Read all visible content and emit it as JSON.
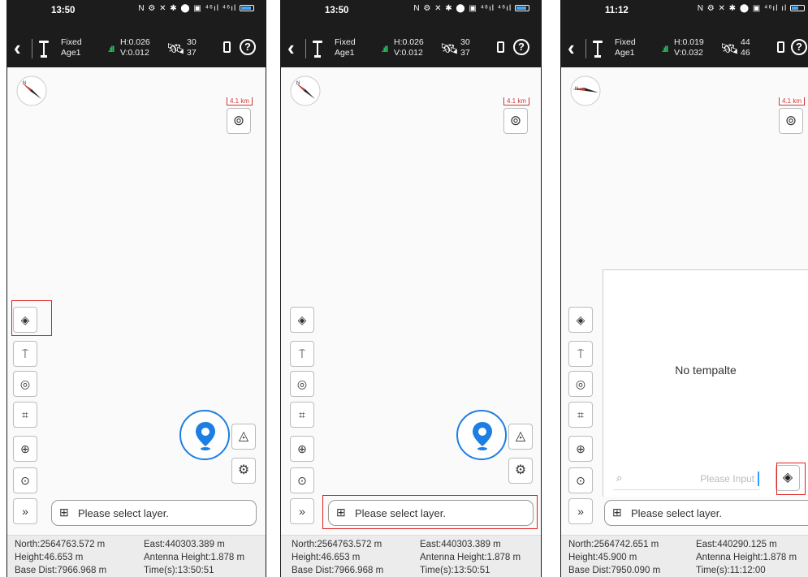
{
  "screens": [
    {
      "time": "13:50",
      "status_icons": "N ⚙ ✕ ✱ ⬤ ▣ ⁴⁶ıl ⁴⁶ıl",
      "fix_status": "Fixed",
      "age": "Age1",
      "h_precision": "H:0.026",
      "v_precision": "V:0.012",
      "sats_used": "30",
      "sats_tracked": "37",
      "scale": "4.1 km",
      "layer_hint": "Please select layer.",
      "north": "North:2564763.572 m",
      "east": "East:440303.389 m",
      "height": "Height:46.653 m",
      "antenna_height": "Antenna Height:1.878 m",
      "base_dist": "Base Dist:7966.968 m",
      "time_s": "Time(s):13:50:51"
    },
    {
      "time": "13:50",
      "status_icons": "N ⚙ ✕ ✱ ⬤ ▣ ⁴⁶ıl ⁴⁶ıl",
      "fix_status": "Fixed",
      "age": "Age1",
      "h_precision": "H:0.026",
      "v_precision": "V:0.012",
      "sats_used": "30",
      "sats_tracked": "37",
      "scale": "4.1 km",
      "layer_hint": "Please select layer.",
      "north": "North:2564763.572 m",
      "east": "East:440303.389 m",
      "height": "Height:46.653 m",
      "antenna_height": "Antenna Height:1.878 m",
      "base_dist": "Base Dist:7966.968 m",
      "time_s": "Time(s):13:50:51"
    },
    {
      "time": "11:12",
      "status_icons": "N ⚙ ✕ ✱ ⬤ ▣ ⁴⁶ıl ıl",
      "fix_status": "Fixed",
      "age": "Age1",
      "h_precision": "H:0.019",
      "v_precision": "V:0.032",
      "sats_used": "44",
      "sats_tracked": "46",
      "scale": "4.1 km",
      "layer_hint": "Please select layer.",
      "north": "North:2564742.651 m",
      "east": "East:440290.125 m",
      "height": "Height:45.900 m",
      "antenna_height": "Antenna Height:1.878 m",
      "base_dist": "Base Dist:7950.090 m",
      "time_s": "Time(s):11:12:00",
      "panel_empty": "No tempalte",
      "panel_search_placeholder": "Please Input"
    }
  ],
  "icons": {
    "back": "‹",
    "help": "?",
    "satellite": "🛰",
    "layers": "◈",
    "location": "⊙",
    "target": "◉",
    "crop": "⌗",
    "collapse": "»",
    "settings": "⚙",
    "mountain": "△",
    "search": "⌕"
  },
  "colors": {
    "bar_bg": "#1c1c1c",
    "accent": "#1d7fe3",
    "highlight": "#e02020",
    "signal": "#25d366"
  }
}
